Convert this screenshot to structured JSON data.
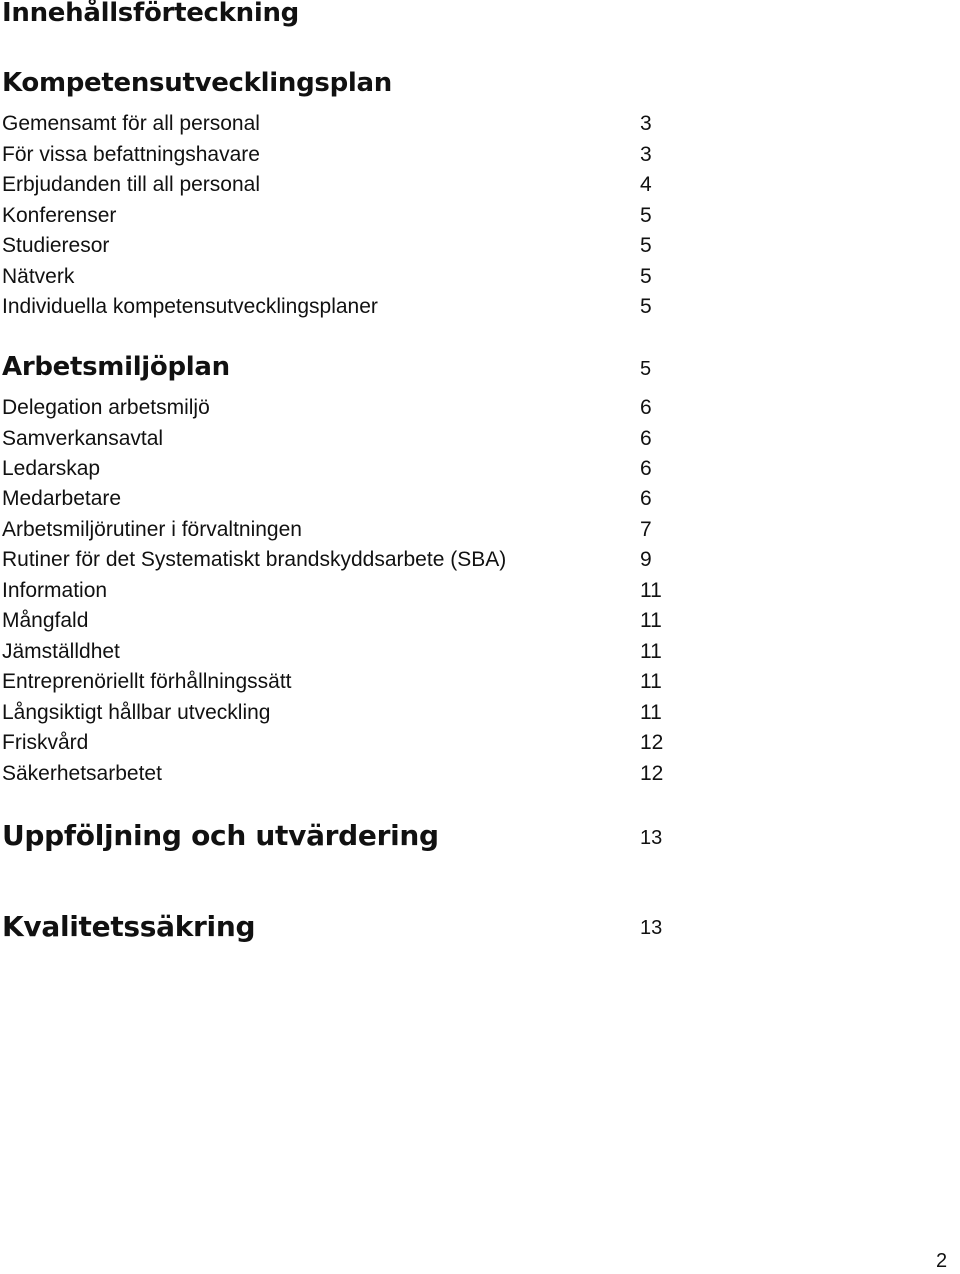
{
  "title": "Innehållsförteckning",
  "sections": [
    {
      "heading": "Kompetensutvecklingsplan",
      "page": "",
      "entries": [
        {
          "label": "Gemensamt för all personal",
          "page": "3"
        },
        {
          "label": "För vissa befattningshavare",
          "page": "3"
        },
        {
          "label": "Erbjudanden till all personal",
          "page": "4"
        },
        {
          "label": "Konferenser",
          "page": "5"
        },
        {
          "label": "Studieresor",
          "page": "5"
        },
        {
          "label": "Nätverk",
          "page": "5"
        },
        {
          "label": "Individuella kompetensutvecklingsplaner",
          "page": "5"
        }
      ]
    },
    {
      "heading": "Arbetsmiljöplan",
      "page": "5",
      "entries": [
        {
          "label": "Delegation arbetsmiljö",
          "page": "6"
        },
        {
          "label": "Samverkansavtal",
          "page": "6"
        },
        {
          "label": "Ledarskap",
          "page": "6"
        },
        {
          "label": "Medarbetare",
          "page": "6"
        },
        {
          "label": "Arbetsmiljörutiner i förvaltningen",
          "page": "7"
        },
        {
          "label": "Rutiner för det Systematiskt brandskyddsarbete (SBA)",
          "page": "9"
        },
        {
          "label": "Information",
          "page": "11"
        },
        {
          "label": "Mångfald",
          "page": "11"
        },
        {
          "label": "Jämställdhet",
          "page": "11"
        },
        {
          "label": "Entreprenöriellt förhållningssätt",
          "page": "11"
        },
        {
          "label": "Långsiktigt hållbar utveckling",
          "page": "11"
        },
        {
          "label": "Friskvård",
          "page": "12"
        },
        {
          "label": "Säkerhetsarbetet",
          "page": "12"
        }
      ]
    },
    {
      "heading": "Uppföljning och utvärdering",
      "page": "13",
      "entries": []
    },
    {
      "heading": "Kvalitetssäkring",
      "page": "13",
      "entries": []
    }
  ],
  "page_number": "2"
}
